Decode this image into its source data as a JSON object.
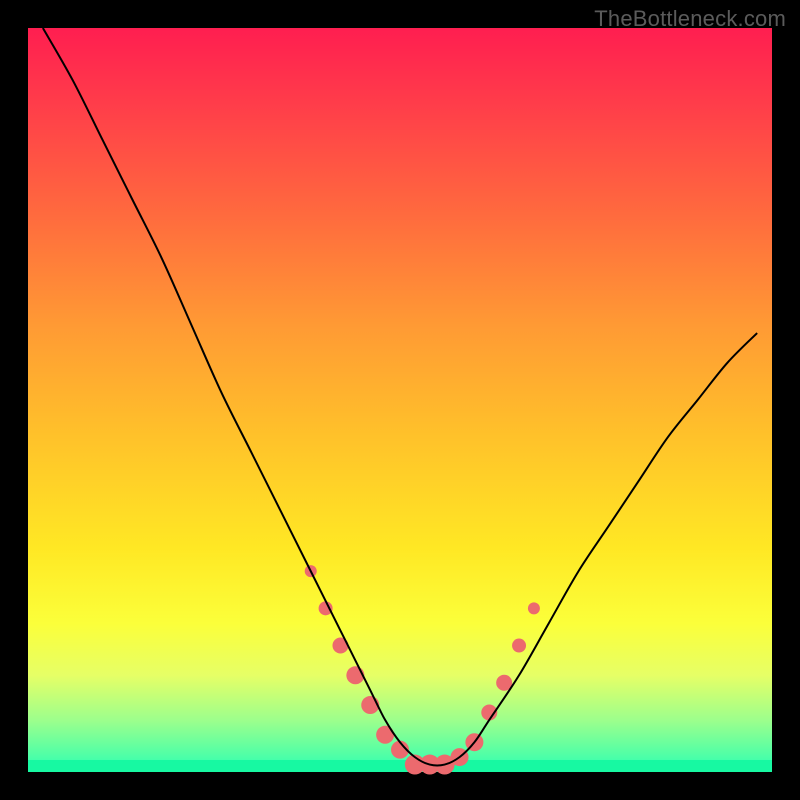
{
  "watermark": "TheBottleneck.com",
  "colors": {
    "bg": "#000000",
    "gradient_top": "#ff1e50",
    "gradient_bottom": "#2bffb3",
    "curve": "#000000",
    "marker": "#ec6a6e"
  },
  "chart_data": {
    "type": "line",
    "title": "",
    "xlabel": "",
    "ylabel": "",
    "xlim": [
      0,
      100
    ],
    "ylim": [
      0,
      100
    ],
    "grid": false,
    "series": [
      {
        "name": "bottleneck-curve",
        "x": [
          2,
          6,
          10,
          14,
          18,
          22,
          26,
          30,
          34,
          38,
          42,
          44,
          46,
          48,
          50,
          52,
          54,
          56,
          58,
          60,
          62,
          66,
          70,
          74,
          78,
          82,
          86,
          90,
          94,
          98
        ],
        "y": [
          100,
          93,
          85,
          77,
          69,
          60,
          51,
          43,
          35,
          27,
          19,
          15,
          11,
          7,
          4,
          2,
          1,
          1,
          2,
          4,
          7,
          13,
          20,
          27,
          33,
          39,
          45,
          50,
          55,
          59
        ]
      }
    ],
    "markers": {
      "name": "highlighted-points",
      "x": [
        38,
        40,
        42,
        44,
        46,
        48,
        50,
        52,
        54,
        56,
        58,
        60,
        62,
        64,
        66,
        68
      ],
      "y": [
        27,
        22,
        17,
        13,
        9,
        5,
        3,
        1,
        1,
        1,
        2,
        4,
        8,
        12,
        17,
        22
      ],
      "radius": [
        6,
        7,
        8,
        9,
        9,
        9,
        9,
        10,
        10,
        10,
        9,
        9,
        8,
        8,
        7,
        6
      ]
    }
  }
}
